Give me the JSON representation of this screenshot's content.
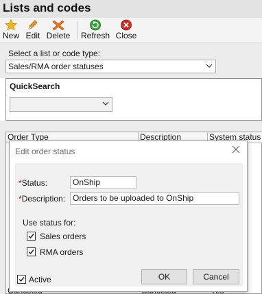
{
  "window": {
    "title": "Lists and codes"
  },
  "toolbar": {
    "new_label": "New",
    "edit_label": "Edit",
    "delete_label": "Delete",
    "refresh_label": "Refresh",
    "close_label": "Close"
  },
  "selector": {
    "label": "Select a list or code type:",
    "value": "Sales/RMA order statuses"
  },
  "quicksearch": {
    "title": "QuickSearch",
    "value": ""
  },
  "grid": {
    "columns": [
      "Order Type",
      "Description",
      "System status"
    ],
    "visible_row_fragments": [
      "Canceled",
      "Canceled",
      "Yes"
    ]
  },
  "dialog": {
    "title": "Edit order status",
    "status_label": "Status:",
    "status_value": "OnShip",
    "description_label": "Description:",
    "description_value": "Orders to be uploaded to OnShip",
    "use_status_for_label": "Use status for:",
    "sales_orders_label": "Sales orders",
    "sales_orders_checked": true,
    "rma_orders_label": "RMA orders",
    "rma_orders_checked": true,
    "active_label": "Active",
    "active_checked": true,
    "ok_label": "OK",
    "cancel_label": "Cancel",
    "required_marker": "*"
  },
  "colors": {
    "required": "#d00000",
    "new_icon": "#f2b51a",
    "edit_icon": "#e79a2a",
    "delete_icon": "#e8771f",
    "refresh_icon": "#3aa23a",
    "close_icon": "#c8342b"
  }
}
